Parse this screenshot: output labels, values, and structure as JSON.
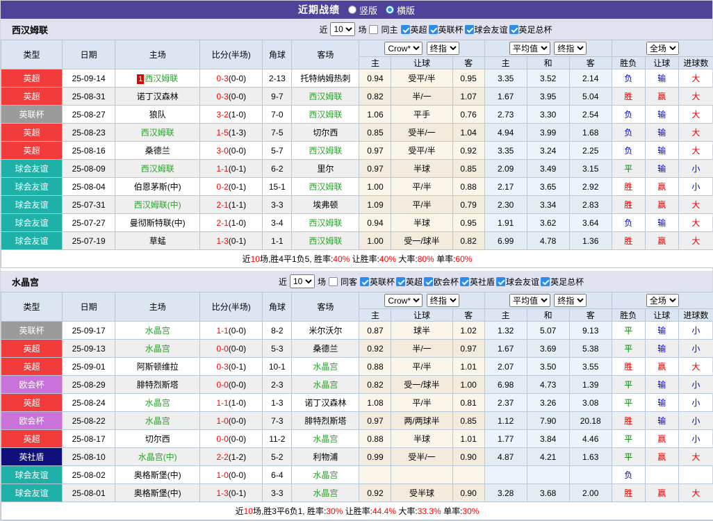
{
  "titlebar": {
    "title": "近期战绩",
    "radio_vertical": "竖版",
    "radio_horizontal": "横版"
  },
  "common": {
    "recent_label": "近",
    "recent_value": "10",
    "games_label": "场",
    "selects": {
      "company": "Crow*",
      "final1": "终指",
      "average": "平均值",
      "final2": "终指",
      "scope": "全场"
    },
    "columns": {
      "type": "类型",
      "date": "日期",
      "home": "主场",
      "score": "比分(半场)",
      "corner": "角球",
      "away": "客场",
      "h": "主",
      "handicap": "让球",
      "a": "客",
      "avg_h": "主",
      "avg_d": "和",
      "avg_a": "客",
      "result": "胜负",
      "handicap_result": "让球",
      "goals": "进球数"
    }
  },
  "colors": {
    "accent_purple": "#4f4299",
    "team_highlight": "#2fa02f",
    "score_red": "#ff0000",
    "league_colors": {
      "英超": "#f23b3b",
      "英联杯": "#9b9b9b",
      "球会友谊": "#1fb1a7",
      "欧会杯": "#c973da",
      "英社盾": "#10107c",
      "英足总杯": "#f23b3b"
    },
    "result_colors": {
      "胜": "#e60000",
      "平": "#008000",
      "负": "#0000cc",
      "赢": "#e60000",
      "输": "#0000cc",
      "大": "#e60000",
      "小": "#0000cc"
    }
  },
  "sections": [
    {
      "team": "西汉姆联",
      "same_label": "同主",
      "leagues": [
        "英超",
        "英联杯",
        "球会友谊",
        "英足总杯"
      ],
      "rows": [
        {
          "type": "英超",
          "date": "25-09-14",
          "rank": "1",
          "home": "西汉姆联",
          "hg": true,
          "score": "0-3",
          "half": "(0-0)",
          "corner": "2-13",
          "away": "托特纳姆热刺",
          "ag": false,
          "odds": [
            "0.94",
            "受平/半",
            "0.95"
          ],
          "avg": [
            "3.35",
            "3.52",
            "2.14"
          ],
          "res": [
            "负",
            "输",
            "大"
          ]
        },
        {
          "type": "英超",
          "date": "25-08-31",
          "home": "诺丁汉森林",
          "hg": false,
          "score": "0-3",
          "half": "(0-0)",
          "corner": "9-7",
          "away": "西汉姆联",
          "ag": true,
          "odds": [
            "0.82",
            "半/一",
            "1.07"
          ],
          "avg": [
            "1.67",
            "3.95",
            "5.04"
          ],
          "res": [
            "胜",
            "赢",
            "大"
          ]
        },
        {
          "type": "英联杯",
          "date": "25-08-27",
          "home": "狼队",
          "hg": false,
          "score": "3-2",
          "half": "(1-0)",
          "corner": "7-0",
          "away": "西汉姆联",
          "ag": true,
          "odds": [
            "1.06",
            "平手",
            "0.76"
          ],
          "avg": [
            "2.73",
            "3.30",
            "2.54"
          ],
          "res": [
            "负",
            "输",
            "大"
          ]
        },
        {
          "type": "英超",
          "date": "25-08-23",
          "home": "西汉姆联",
          "hg": true,
          "score": "1-5",
          "half": "(1-3)",
          "corner": "7-5",
          "away": "切尔西",
          "ag": false,
          "odds": [
            "0.85",
            "受半/一",
            "1.04"
          ],
          "avg": [
            "4.94",
            "3.99",
            "1.68"
          ],
          "res": [
            "负",
            "输",
            "大"
          ]
        },
        {
          "type": "英超",
          "date": "25-08-16",
          "home": "桑德兰",
          "hg": false,
          "score": "3-0",
          "half": "(0-0)",
          "corner": "5-7",
          "away": "西汉姆联",
          "ag": true,
          "odds": [
            "0.97",
            "受平/半",
            "0.92"
          ],
          "avg": [
            "3.35",
            "3.24",
            "2.25"
          ],
          "res": [
            "负",
            "输",
            "大"
          ]
        },
        {
          "type": "球会友谊",
          "date": "25-08-09",
          "home": "西汉姆联",
          "hg": true,
          "score": "1-1",
          "half": "(0-1)",
          "corner": "6-2",
          "away": "里尔",
          "ag": false,
          "odds": [
            "0.97",
            "半球",
            "0.85"
          ],
          "avg": [
            "2.09",
            "3.49",
            "3.15"
          ],
          "res": [
            "平",
            "输",
            "小"
          ]
        },
        {
          "type": "球会友谊",
          "date": "25-08-04",
          "home": "伯恩茅斯(中)",
          "hg": false,
          "score": "0-2",
          "half": "(0-1)",
          "corner": "15-1",
          "away": "西汉姆联",
          "ag": true,
          "odds": [
            "1.00",
            "平/半",
            "0.88"
          ],
          "avg": [
            "2.17",
            "3.65",
            "2.92"
          ],
          "res": [
            "胜",
            "赢",
            "小"
          ]
        },
        {
          "type": "球会友谊",
          "date": "25-07-31",
          "home": "西汉姆联(中)",
          "hg": true,
          "score": "2-1",
          "half": "(1-1)",
          "corner": "3-3",
          "away": "埃弗顿",
          "ag": false,
          "odds": [
            "1.09",
            "平/半",
            "0.79"
          ],
          "avg": [
            "2.30",
            "3.34",
            "2.83"
          ],
          "res": [
            "胜",
            "赢",
            "大"
          ]
        },
        {
          "type": "球会友谊",
          "date": "25-07-27",
          "home": "曼彻斯特联(中)",
          "hg": false,
          "score": "2-1",
          "half": "(1-0)",
          "corner": "3-4",
          "away": "西汉姆联",
          "ag": true,
          "odds": [
            "0.94",
            "半球",
            "0.95"
          ],
          "avg": [
            "1.91",
            "3.62",
            "3.64"
          ],
          "res": [
            "负",
            "输",
            "大"
          ]
        },
        {
          "type": "球会友谊",
          "date": "25-07-19",
          "home": "草蜢",
          "hg": false,
          "score": "1-3",
          "half": "(0-1)",
          "corner": "1-1",
          "away": "西汉姆联",
          "ag": true,
          "odds": [
            "1.00",
            "受一/球半",
            "0.82"
          ],
          "avg": [
            "6.99",
            "4.78",
            "1.36"
          ],
          "res": [
            "胜",
            "赢",
            "大"
          ]
        }
      ],
      "summary": [
        {
          "t": "近"
        },
        {
          "t": "10",
          "red": true
        },
        {
          "t": "场,胜4平1负5, 胜率:"
        },
        {
          "t": "40%",
          "red": true
        },
        {
          "t": " 让胜率:"
        },
        {
          "t": "40%",
          "red": true
        },
        {
          "t": " 大率:"
        },
        {
          "t": "80%",
          "red": true
        },
        {
          "t": " 单率:"
        },
        {
          "t": "60%",
          "red": true
        }
      ]
    },
    {
      "team": "水晶宫",
      "same_label": "同客",
      "leagues": [
        "英联杯",
        "英超",
        "欧会杯",
        "英社盾",
        "球会友谊",
        "英足总杯"
      ],
      "rows": [
        {
          "type": "英联杯",
          "date": "25-09-17",
          "home": "水晶宫",
          "hg": true,
          "score": "1-1",
          "half": "(0-0)",
          "corner": "8-2",
          "away": "米尔沃尔",
          "ag": false,
          "odds": [
            "0.87",
            "球半",
            "1.02"
          ],
          "avg": [
            "1.32",
            "5.07",
            "9.13"
          ],
          "res": [
            "平",
            "输",
            "小"
          ]
        },
        {
          "type": "英超",
          "date": "25-09-13",
          "home": "水晶宫",
          "hg": true,
          "score": "0-0",
          "half": "(0-0)",
          "corner": "5-3",
          "away": "桑德兰",
          "ag": false,
          "odds": [
            "0.92",
            "半/一",
            "0.97"
          ],
          "avg": [
            "1.67",
            "3.69",
            "5.38"
          ],
          "res": [
            "平",
            "输",
            "小"
          ]
        },
        {
          "type": "英超",
          "date": "25-09-01",
          "home": "阿斯顿维拉",
          "hg": false,
          "score": "0-3",
          "half": "(0-1)",
          "corner": "10-1",
          "away": "水晶宫",
          "ag": true,
          "odds": [
            "0.88",
            "平/半",
            "1.01"
          ],
          "avg": [
            "2.07",
            "3.50",
            "3.55"
          ],
          "res": [
            "胜",
            "赢",
            "大"
          ]
        },
        {
          "type": "欧会杯",
          "date": "25-08-29",
          "home": "腓特烈斯塔",
          "hg": false,
          "score": "0-0",
          "half": "(0-0)",
          "corner": "2-3",
          "away": "水晶宫",
          "ag": true,
          "odds": [
            "0.82",
            "受一/球半",
            "1.00"
          ],
          "avg": [
            "6.98",
            "4.73",
            "1.39"
          ],
          "res": [
            "平",
            "输",
            "小"
          ]
        },
        {
          "type": "英超",
          "date": "25-08-24",
          "home": "水晶宫",
          "hg": true,
          "score": "1-1",
          "half": "(1-0)",
          "corner": "1-3",
          "away": "诺丁汉森林",
          "ag": false,
          "odds": [
            "1.08",
            "平/半",
            "0.81"
          ],
          "avg": [
            "2.37",
            "3.26",
            "3.08"
          ],
          "res": [
            "平",
            "输",
            "小"
          ]
        },
        {
          "type": "欧会杯",
          "date": "25-08-22",
          "home": "水晶宫",
          "hg": true,
          "score": "1-0",
          "half": "(0-0)",
          "corner": "7-3",
          "away": "腓特烈斯塔",
          "ag": false,
          "odds": [
            "0.97",
            "两/两球半",
            "0.85"
          ],
          "avg": [
            "1.12",
            "7.90",
            "20.18"
          ],
          "res": [
            "胜",
            "输",
            "小"
          ]
        },
        {
          "type": "英超",
          "date": "25-08-17",
          "home": "切尔西",
          "hg": false,
          "score": "0-0",
          "half": "(0-0)",
          "corner": "11-2",
          "away": "水晶宫",
          "ag": true,
          "odds": [
            "0.88",
            "半球",
            "1.01"
          ],
          "avg": [
            "1.77",
            "3.84",
            "4.46"
          ],
          "res": [
            "平",
            "赢",
            "小"
          ]
        },
        {
          "type": "英社盾",
          "date": "25-08-10",
          "home": "水晶宫(中)",
          "hg": true,
          "score": "2-2",
          "half": "(1-2)",
          "corner": "5-2",
          "away": "利物浦",
          "ag": false,
          "odds": [
            "0.99",
            "受半/一",
            "0.90"
          ],
          "avg": [
            "4.87",
            "4.21",
            "1.63"
          ],
          "res": [
            "平",
            "赢",
            "大"
          ]
        },
        {
          "type": "球会友谊",
          "date": "25-08-02",
          "home": "奥格斯堡(中)",
          "hg": false,
          "score": "1-0",
          "half": "(0-0)",
          "corner": "6-4",
          "away": "水晶宫",
          "ag": true,
          "odds": [
            "",
            "",
            ""
          ],
          "avg": [
            "",
            "",
            ""
          ],
          "res": [
            "负",
            "",
            ""
          ]
        },
        {
          "type": "球会友谊",
          "date": "25-08-01",
          "home": "奥格斯堡(中)",
          "hg": false,
          "score": "1-3",
          "half": "(0-1)",
          "corner": "3-3",
          "away": "水晶宫",
          "ag": true,
          "odds": [
            "0.92",
            "受半球",
            "0.90"
          ],
          "avg": [
            "3.28",
            "3.68",
            "2.00"
          ],
          "res": [
            "胜",
            "赢",
            "大"
          ]
        }
      ],
      "summary": [
        {
          "t": "近"
        },
        {
          "t": "10",
          "red": true
        },
        {
          "t": "场,胜3平6负1, 胜率:"
        },
        {
          "t": "30%",
          "red": true
        },
        {
          "t": " 让胜率:"
        },
        {
          "t": "44.4%",
          "red": true
        },
        {
          "t": " 大率:"
        },
        {
          "t": "33.3%",
          "red": true
        },
        {
          "t": " 单率:"
        },
        {
          "t": "30%",
          "red": true
        }
      ]
    }
  ]
}
